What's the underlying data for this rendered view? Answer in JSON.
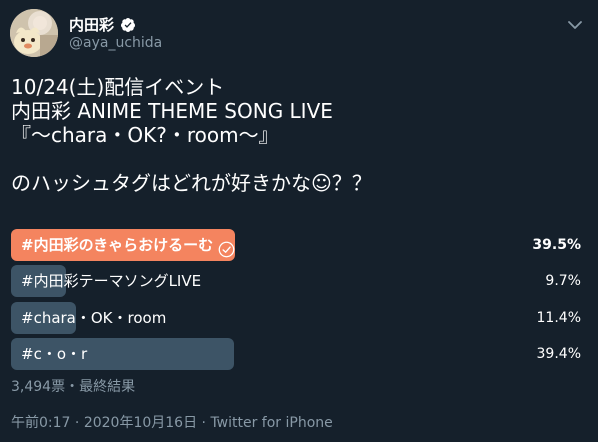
{
  "author": {
    "display_name": "内田彩",
    "handle": "@aya_uchida",
    "verified": true
  },
  "tweet": {
    "lines": [
      "10/24(土)配信イベント",
      "内田彩 ANIME THEME SONG LIVE",
      "『～chara・OK?・room～』",
      "",
      "のハッシュタグはどれが好きかな☺？？"
    ]
  },
  "poll": {
    "options": [
      {
        "label": "#内田彩のきゃらおけるーむ",
        "percent": "39.5%",
        "value": 0.395,
        "winner": true
      },
      {
        "label": "#内田彩テーマソングLIVE",
        "percent": "9.7%",
        "value": 0.097,
        "winner": false
      },
      {
        "label": "#chara・OK・room",
        "percent": "11.4%",
        "value": 0.114,
        "winner": false
      },
      {
        "label": "#c・o・r",
        "percent": "39.4%",
        "value": 0.394,
        "winner": false
      }
    ],
    "footer": "3,494票・最終結果"
  },
  "meta": {
    "time": "午前0:17",
    "separator1": "·",
    "date": "2020年10月16日",
    "separator2": "·",
    "source": "Twitter for iPhone"
  },
  "colors": {
    "background": "#15202b",
    "winner_bar": "#f4845f",
    "bar": "#3d5466",
    "muted": "#8899a6",
    "verified": "#ffffff"
  },
  "icons": {
    "verified": "verified-badge-icon",
    "chevron": "chevron-down-icon",
    "check": "check-circle-icon"
  }
}
